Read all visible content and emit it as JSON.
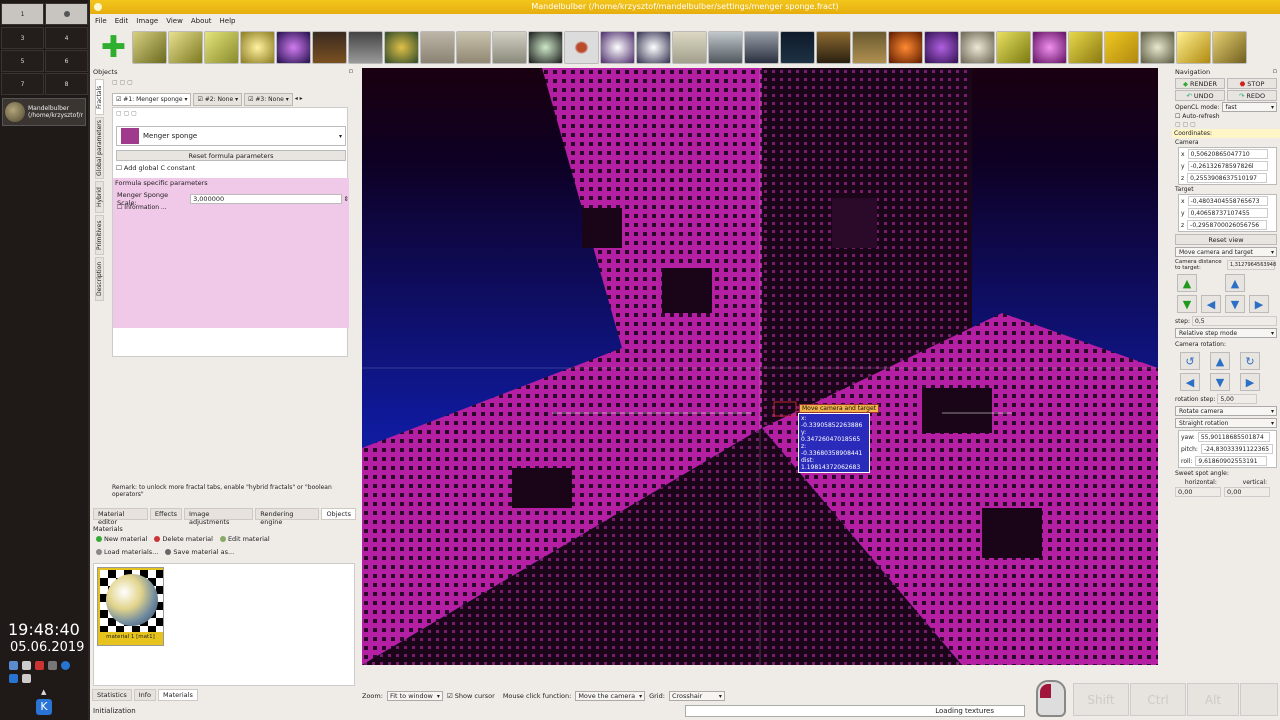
{
  "desktop": {
    "workspaces": [
      "1",
      "2",
      "3",
      "4",
      "5",
      "6",
      "7",
      "8"
    ],
    "task_label": "Mandelbulber (/home/krzysztof/mandelbulber/s...",
    "clock": "19:48:40",
    "date": "05.06.2019"
  },
  "window": {
    "title": "Mandelbulber (/home/krzysztof/mandelbulber/settings/menger sponge.fract)"
  },
  "menu": [
    "File",
    "Edit",
    "Image",
    "View",
    "About",
    "Help"
  ],
  "objects_panel": {
    "header": "Objects",
    "vertical_tabs": [
      "Fractals",
      "Global parameters",
      "Hybrid",
      "Primitives",
      "Description"
    ],
    "fractal_tabs": [
      "#1: Menger sponge",
      "#2: None",
      "#3: None"
    ],
    "formula_name": "Menger sponge",
    "reset_button": "Reset formula parameters",
    "add_global_c": "Add global C constant",
    "formula_params_header": "Formula specific parameters",
    "scale_label": "Menger Sponge Scale:",
    "scale_value": "3,000000",
    "information": "Information ...",
    "remark": "Remark: to unlock more fractal tabs, enable \"hybrid fractals\" or \"boolean operators\""
  },
  "bottom_tabs": [
    "Material editor",
    "Effects",
    "Image adjustments",
    "Rendering engine",
    "Objects"
  ],
  "materials": {
    "header": "Materials",
    "buttons": [
      "New material",
      "Delete material",
      "Edit material",
      "Load materials...",
      "Save material as..."
    ],
    "item_label": "material 1 [mat1]"
  },
  "left_bottom_tabs": [
    "Statistics",
    "Info",
    "Materials"
  ],
  "viewport": {
    "tooltip_title": "Move camera and target",
    "tooltip_lines": [
      "x: -0.33905852263886",
      "y: 0.34726047018565",
      "z: -0.33680358908441",
      "dist: 1.19814372062683"
    ]
  },
  "viewport_bar": {
    "zoom_label": "Zoom:",
    "zoom_value": "Fit to window",
    "show_cursor": "Show cursor",
    "mouse_click_label": "Mouse click function:",
    "mouse_click_value": "Move the camera",
    "grid_label": "Grid:",
    "grid_value": "Crosshair"
  },
  "status": {
    "left": "Initialization",
    "progress": "Loading textures"
  },
  "keys": [
    "Shift",
    "Ctrl",
    "Alt"
  ],
  "navigation": {
    "header": "Navigation",
    "render": "RENDER",
    "stop": "STOP",
    "undo": "UNDO",
    "redo": "REDO",
    "opencl_label": "OpenCL mode:",
    "opencl_value": "fast",
    "auto_refresh": "Auto-refresh",
    "coordinates": "Coordinates:",
    "camera_label": "Camera",
    "camera": [
      "0,50620865047710",
      "-0,26132678597826l",
      "0,2553908637510197"
    ],
    "target_label": "Target",
    "target": [
      "-0,4803404558765673",
      "0,40658737107455",
      "-0,2958700026056756"
    ],
    "reset_view": "Reset view",
    "move_mode": "Move camera and target",
    "camera_distance_label": "Camera distance to target:",
    "camera_distance": "1,3127964563948",
    "step_label": "step:",
    "step_value": "0,5",
    "relative_mode": "Relative step mode",
    "camera_rotation": "Camera rotation:",
    "rotation_step_label": "rotation step:",
    "rotation_step": "5,00",
    "rotate_mode": "Rotate camera",
    "straight_rotation": "Straight rotation",
    "yaw_label": "yaw:",
    "yaw": "55,90118685501874",
    "pitch_label": "pitch:",
    "pitch": "-24,83033391122365",
    "roll_label": "roll:",
    "roll": "9,61860902553191",
    "sweet_spot": "Sweet spot angle:",
    "horizontal_label": "horizontal:",
    "vertical_label": "vertical:",
    "horizontal": "0,00",
    "vertical": "0,00"
  }
}
